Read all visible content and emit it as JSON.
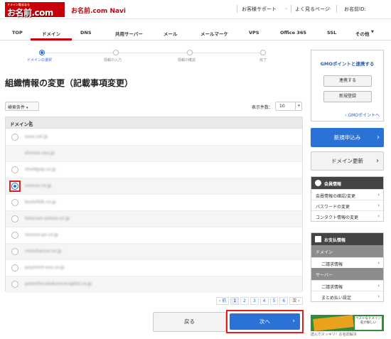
{
  "header": {
    "logo_small": "ドメイン取るなら",
    "logo_main": "お名前.com",
    "app_name": "お名前.com Navi",
    "links": [
      "お客様サポート",
      "よく見るページ",
      "お名前ID:"
    ]
  },
  "nav": {
    "tabs": [
      "TOP",
      "ドメイン",
      "DNS",
      "共用サーバー",
      "メール",
      "メールマーケ",
      "VPS",
      "Office 365",
      "SSL",
      "その他"
    ],
    "active": "ドメイン"
  },
  "steps": [
    "ドメインの選択",
    "情報の入力",
    "情報の確認",
    "完了"
  ],
  "page_title": "組織情報の変更（記載事項変更）",
  "filter_label": "検索条件",
  "per_page": {
    "label": "表示件数：",
    "value": "10"
  },
  "table": {
    "header": "ドメイン名",
    "rows": [
      {
        "domain": "xxxx.xxl.jp",
        "selected": false,
        "radio": true
      },
      {
        "domain": "xhxxxx.xxx.jp",
        "selected": false,
        "radio": false
      },
      {
        "domain": "xhxldgxp.co.jp",
        "selected": false,
        "radio": true
      },
      {
        "domain": "xxxxxx.co.jp",
        "selected": true,
        "radio": true
      },
      {
        "domain": "bxxtxfxlk.co.jp",
        "selected": false,
        "radio": true
      },
      {
        "domain": "txlxcxxn-xxlxxx.co.jp",
        "selected": false,
        "radio": true
      },
      {
        "domain": "xxxxxx-px.co.jp",
        "selected": false,
        "radio": true
      },
      {
        "domain": "rxntxlsxrvxr.co.jp",
        "selected": false,
        "radio": true
      },
      {
        "domain": "pxymxnt-xxx.co.jp",
        "selected": false,
        "radio": true
      },
      {
        "domain": "pxtxntlxcxlxdvxncxcxpitxl.co.jp",
        "selected": false,
        "radio": true
      }
    ]
  },
  "pager": {
    "prev": "‹ 前",
    "pages": [
      "1",
      "2",
      "3",
      "4",
      "5",
      "6"
    ],
    "current": "1",
    "next": "次 ›"
  },
  "buttons": {
    "back": "戻る",
    "next": "次へ"
  },
  "sidebar": {
    "gmo": {
      "title": "GMOポイントと連携する",
      "link_btn": "連携する",
      "register_btn": "新規登録",
      "link": "› GMOポイントへ"
    },
    "new_app": "新規申込み",
    "renew": "ドメイン更新",
    "member": {
      "title": "会員情報",
      "items": [
        "会員情報の確認/変更",
        "パスワードの変更",
        "コンタクト情報の変更"
      ]
    },
    "payment": {
      "title": "お支払情報",
      "sections": [
        {
          "name": "ドメイン",
          "items": [
            "ご請求情報"
          ]
        },
        {
          "name": "サーバー",
          "items": [
            "ご請求情報",
            "まとめ払い設定"
          ]
        }
      ]
    },
    "ad": {
      "text": "ベストなドメイン名が探しい",
      "caption": "読んでスッキリ！お名前解決"
    }
  },
  "colors": {
    "brand_red": "#c8000a",
    "primary_blue": "#2b72d6",
    "highlight_red": "#e02020"
  }
}
